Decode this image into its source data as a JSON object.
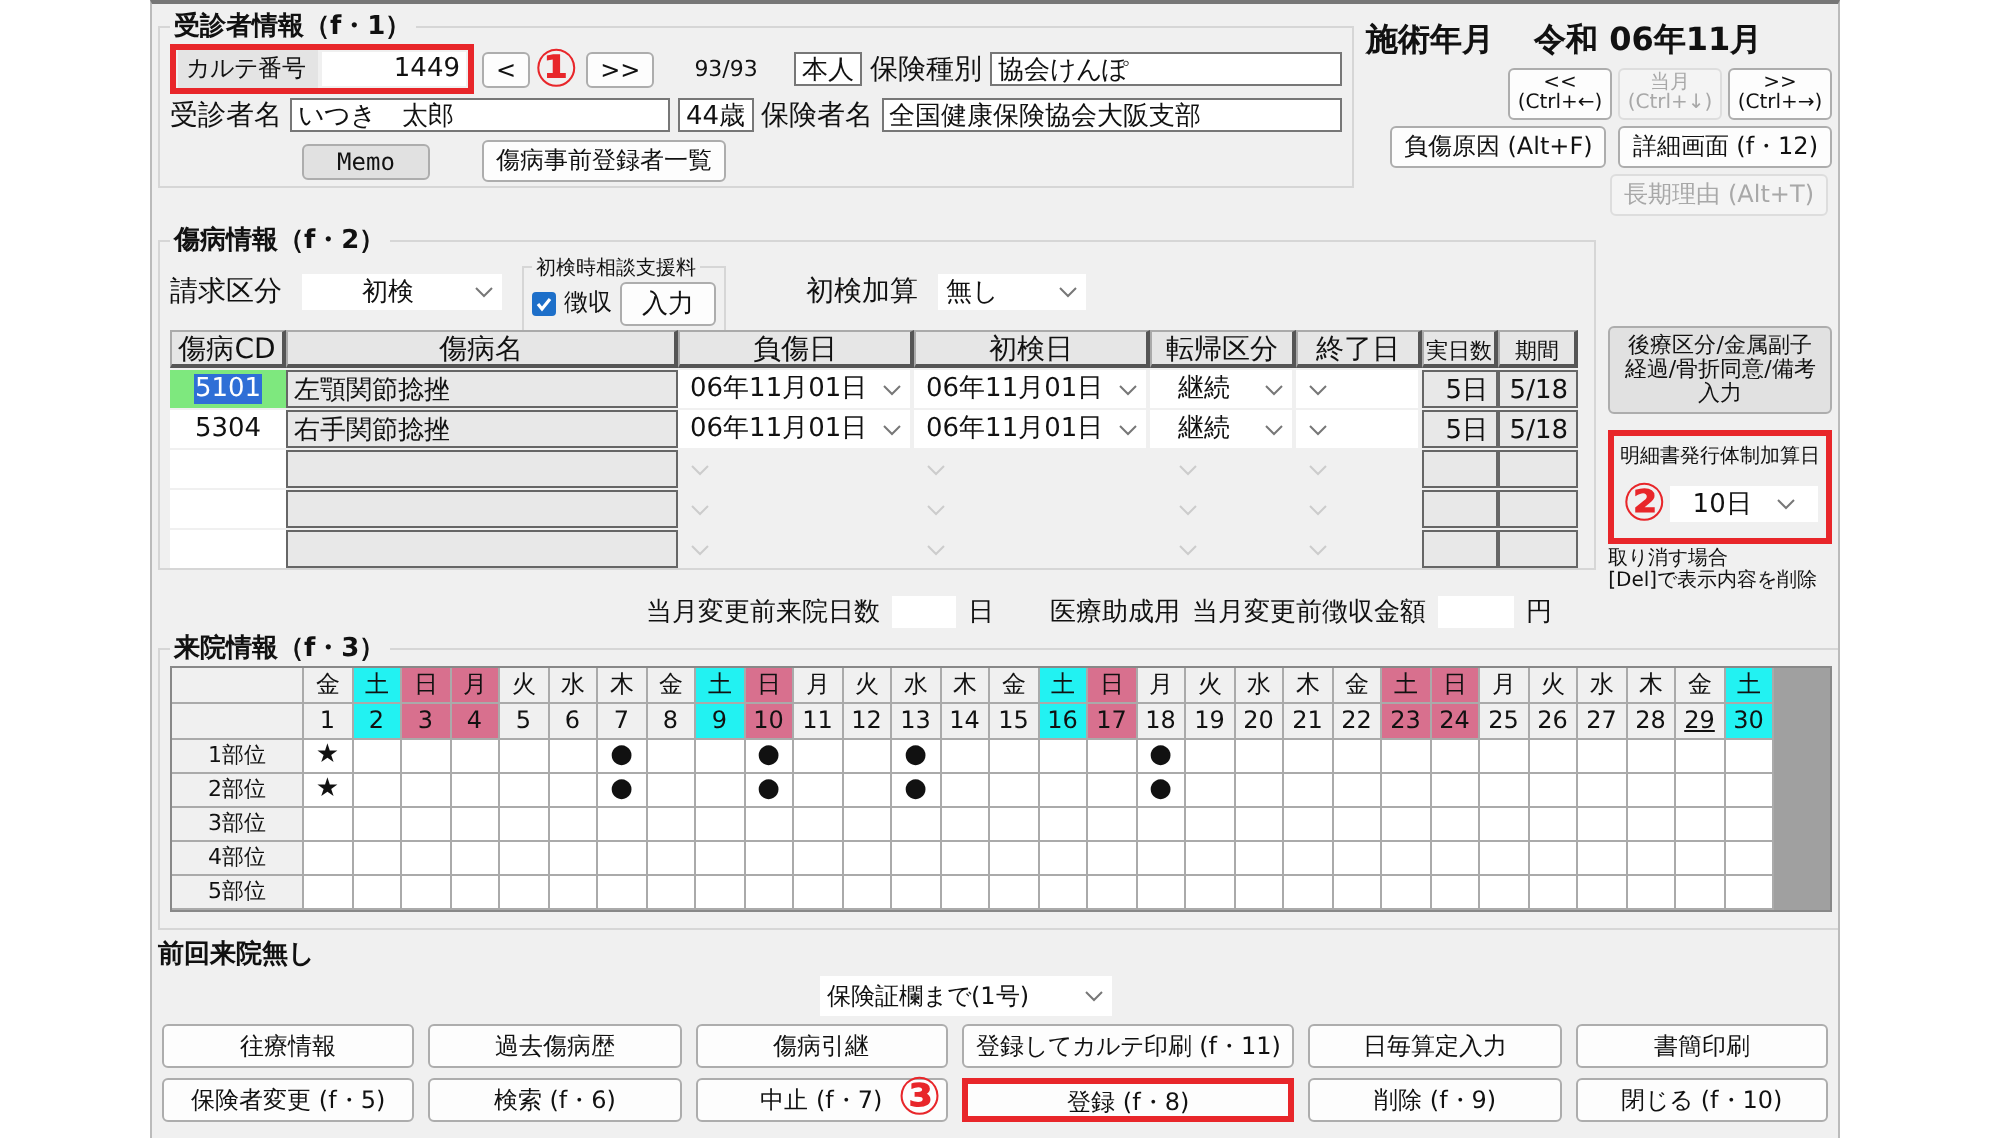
{
  "patient_info": {
    "title": "受診者情報（f・1）",
    "chart_number": {
      "label": "カルテ番号",
      "value": "1449",
      "highlighted": true,
      "callout": "①"
    },
    "prev_button": "<",
    "next_button": ">>",
    "record_count": "93/93",
    "relation": "本人",
    "insurance_type": {
      "label": "保険種別",
      "value": "協会けんぽ"
    },
    "patient_name": {
      "label": "受診者名",
      "value": "いつき　太郎"
    },
    "age": "44歳",
    "insurer_name": {
      "label": "保険者名",
      "value": "全国健康保険協会大阪支部"
    },
    "memo_button": "Memo",
    "preregistered_button": "傷病事前登録者一覧"
  },
  "treatment_month": {
    "label": "施術年月",
    "era": "令和",
    "value": "06年11月"
  },
  "month_nav": [
    {
      "label": "<<",
      "shortcut": "(Ctrl+←)",
      "disabled": false
    },
    {
      "label": "当月",
      "shortcut": "(Ctrl+↓)",
      "disabled": true
    },
    {
      "label": ">>",
      "shortcut": "(Ctrl+→)",
      "disabled": false
    }
  ],
  "side_buttons": [
    {
      "label": "負傷原因 (Alt+F)",
      "disabled": false
    },
    {
      "label": "詳細画面 (f・12)",
      "disabled": false
    },
    {
      "label": "長期理由 (Alt+T)",
      "disabled": true
    }
  ],
  "injury_info": {
    "title": "傷病情報（f・2）",
    "billing": {
      "label": "請求区分",
      "value": "初検"
    },
    "consult_fee": {
      "title": "初検時相談支援料",
      "checkbox": {
        "label": "徴収",
        "checked": true
      },
      "button": "入力"
    },
    "first_visit_addition": {
      "label": "初検加算",
      "value": "無し"
    },
    "columns": [
      "傷病CD",
      "傷病名",
      "負傷日",
      "初検日",
      "転帰区分",
      "終了日",
      "実日数",
      "期間"
    ],
    "rows": [
      {
        "code": "5101",
        "name": "左顎関節捻挫",
        "injury_date": "06年11月01日",
        "first_visit_date": "06年11月01日",
        "outcome": "継続",
        "days": "5日",
        "period": "5/18",
        "selected": true
      },
      {
        "code": "5304",
        "name": "右手関節捻挫",
        "injury_date": "06年11月01日",
        "first_visit_date": "06年11月01日",
        "outcome": "継続",
        "days": "5日",
        "period": "5/18",
        "selected": false
      },
      {
        "selected": false
      },
      {
        "selected": false
      },
      {
        "selected": false
      }
    ]
  },
  "aftercare_button": [
    "後療区分/金属副子",
    "経過/骨折同意/備考",
    "入力"
  ],
  "statement_addition": {
    "label": "明細書発行体制加算日",
    "value": "10日",
    "highlighted": true,
    "callout": "②"
  },
  "delete_hint": [
    "取り消す場合",
    "[Del]で表示内容を削除"
  ],
  "monthly_change": {
    "visits_label": "当月変更前来院日数",
    "visits_unit": "日",
    "subsidy_label": "医療助成用",
    "amount_label": "当月変更前徴収金額",
    "amount_unit": "円"
  },
  "visit_info": {
    "title": "来院情報（f・3）",
    "days": [
      {
        "weekday": "金",
        "date": "1",
        "underlined": false,
        "part_marks": [
          "★",
          "★"
        ]
      },
      {
        "weekday": "土",
        "date": "2",
        "color": "#22f2f2",
        "underlined": false
      },
      {
        "weekday": "日",
        "date": "3",
        "color": "#d8708e",
        "underlined": false
      },
      {
        "weekday": "月",
        "date": "4",
        "color": "#d8708e",
        "underlined": false
      },
      {
        "weekday": "火",
        "date": "5",
        "underlined": false
      },
      {
        "weekday": "水",
        "date": "6",
        "underlined": false
      },
      {
        "weekday": "木",
        "date": "7",
        "underlined": false,
        "part_marks": [
          "●",
          "●"
        ]
      },
      {
        "weekday": "金",
        "date": "8",
        "underlined": false
      },
      {
        "weekday": "土",
        "date": "9",
        "color": "#22f2f2",
        "underlined": false
      },
      {
        "weekday": "日",
        "date": "10",
        "color": "#d8708e",
        "underlined": false,
        "part_marks": [
          "●",
          "●"
        ]
      },
      {
        "weekday": "月",
        "date": "11",
        "underlined": false
      },
      {
        "weekday": "火",
        "date": "12",
        "underlined": false
      },
      {
        "weekday": "水",
        "date": "13",
        "underlined": false,
        "part_marks": [
          "●",
          "●"
        ]
      },
      {
        "weekday": "木",
        "date": "14",
        "underlined": false
      },
      {
        "weekday": "金",
        "date": "15",
        "underlined": false
      },
      {
        "weekday": "土",
        "date": "16",
        "color": "#22f2f2",
        "underlined": false
      },
      {
        "weekday": "日",
        "date": "17",
        "color": "#d8708e",
        "underlined": false
      },
      {
        "weekday": "月",
        "date": "18",
        "underlined": false,
        "part_marks": [
          "●",
          "●"
        ]
      },
      {
        "weekday": "火",
        "date": "19",
        "underlined": false
      },
      {
        "weekday": "水",
        "date": "20",
        "underlined": false
      },
      {
        "weekday": "木",
        "date": "21",
        "underlined": false
      },
      {
        "weekday": "金",
        "date": "22",
        "underlined": false
      },
      {
        "weekday": "土",
        "date": "23",
        "color": "#d8708e",
        "underlined": false
      },
      {
        "weekday": "日",
        "date": "24",
        "color": "#d8708e",
        "underlined": false
      },
      {
        "weekday": "月",
        "date": "25",
        "underlined": false
      },
      {
        "weekday": "火",
        "date": "26",
        "underlined": false
      },
      {
        "weekday": "水",
        "date": "27",
        "underlined": false
      },
      {
        "weekday": "木",
        "date": "28",
        "underlined": false
      },
      {
        "weekday": "金",
        "date": "29",
        "underlined": true
      },
      {
        "weekday": "土",
        "date": "30",
        "color": "#22f2f2",
        "underlined": false
      }
    ],
    "parts": [
      {
        "label": "1部位"
      },
      {
        "label": "2部位"
      },
      {
        "label": "3部位"
      },
      {
        "label": "4部位"
      },
      {
        "label": "5部位"
      }
    ]
  },
  "last_visit": "前回来院無し",
  "print_range": "保険証欄まで(1号)",
  "buttons": [
    {
      "label": "往療情報",
      "highlighted": false
    },
    {
      "label": "過去傷病歴",
      "highlighted": false
    },
    {
      "label": "傷病引継",
      "highlighted": false
    },
    {
      "label": "登録してカルテ印刷 (f・11)",
      "highlighted": false
    },
    {
      "label": "日毎算定入力",
      "highlighted": false
    },
    {
      "label": "書簡印刷",
      "highlighted": false
    },
    {
      "label": "保険者変更 (f・5)",
      "highlighted": false
    },
    {
      "label": "検索 (f・6)",
      "highlighted": false
    },
    {
      "label": "中止 (f・7)",
      "highlighted": false
    },
    {
      "label": "登録 (f・8)",
      "highlighted": true,
      "callout": "③"
    },
    {
      "label": "削除 (f・9)",
      "highlighted": false
    },
    {
      "label": "閉じる (f・10)",
      "highlighted": false
    }
  ]
}
